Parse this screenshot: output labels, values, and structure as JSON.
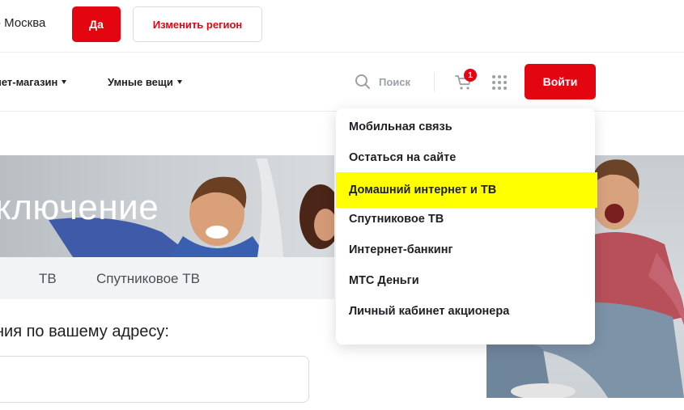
{
  "region": {
    "question": "- Москва",
    "yes_label": "Да",
    "change_label": "Изменить регион"
  },
  "nav": {
    "items": [
      "нет-магазин",
      "Умные вещи"
    ],
    "search_label": "Поиск",
    "cart_count": "1",
    "login_label": "Войти"
  },
  "hero": {
    "title": "ключение"
  },
  "tabs": [
    "ТВ",
    "Спутниковое ТВ"
  ],
  "address": {
    "label": "ния по вашему адресу:",
    "value": ""
  },
  "dropdown": {
    "items": [
      "Мобильная связь",
      "Остаться на сайте",
      "Домашний интернет и ТВ",
      "Спутниковое ТВ",
      "Интернет-банкинг",
      "МТС Деньги",
      "Личный кабинет акционера"
    ],
    "highlighted": "Домашний интернет и ТВ",
    "highlight_color": "#ffff00"
  },
  "colors": {
    "accent": "#e30611"
  }
}
